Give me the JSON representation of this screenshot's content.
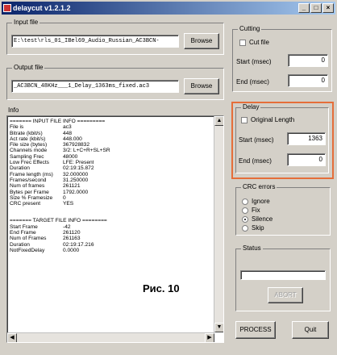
{
  "window": {
    "title": "delaycut v1.2.1.2",
    "minimize": "_",
    "maximize": "□",
    "close": "×"
  },
  "input_file": {
    "label": "Input file",
    "value": "E:\\test\\rls_01_IBel69_Audio_Russian_AC3BCN-",
    "browse": "Browse"
  },
  "output_file": {
    "label": "Output file",
    "value": "_AC3BCN_48KHz___1_Delay_1363ms_fixed.ac3",
    "browse": "Browse"
  },
  "cutting": {
    "label": "Cutting",
    "cut_file": "Cut file",
    "start_label": "Start (msec)",
    "start_value": "0",
    "end_label": "End (msec)",
    "end_value": "0"
  },
  "delay": {
    "label": "Delay",
    "original_length": "Original Length",
    "start_label": "Start (msec)",
    "start_value": "1363",
    "end_label": "End (msec)",
    "end_value": "0"
  },
  "crc": {
    "label": "CRC errors",
    "options": [
      "Ignore",
      "Fix",
      "Silence",
      "Skip"
    ],
    "selected": "Silence"
  },
  "status": {
    "label": "Status",
    "abort": "ABORT"
  },
  "buttons": {
    "process": "PROCESS",
    "quit": "Quit"
  },
  "info": {
    "label": "Info",
    "input_header": "======= INPUT FILE INFO =========",
    "input_rows": [
      {
        "k": "File is",
        "v": "ac3"
      },
      {
        "k": "Bitrate (kbit/s)",
        "v": "448"
      },
      {
        "k": "Act rate (kbit/s)",
        "v": "448.000"
      },
      {
        "k": "File size (bytes)",
        "v": "367928832"
      },
      {
        "k": "Channels mode",
        "v": "3/2: L+C+R+SL+SR"
      },
      {
        "k": "Sampling Frec",
        "v": "48000"
      },
      {
        "k": "Low Frec Effects",
        "v": "LFE: Present"
      },
      {
        "k": "Duration",
        "v": "02:19:15.872"
      },
      {
        "k": "Frame length (ms)",
        "v": "32.000000"
      },
      {
        "k": "Frames/second",
        "v": "31.250000"
      },
      {
        "k": "Num of frames",
        "v": "261121"
      },
      {
        "k": "Bytes per Frame",
        "v": "1792.0000"
      },
      {
        "k": "Size % Framesize",
        "v": "0"
      },
      {
        "k": "CRC present",
        "v": "YES"
      }
    ],
    "target_header": "======= TARGET FILE INFO ========",
    "target_rows": [
      {
        "k": "Start Frame",
        "v": "-42"
      },
      {
        "k": "End Frame",
        "v": "261120"
      },
      {
        "k": "Num of Frames",
        "v": "261163"
      },
      {
        "k": "Duration",
        "v": "02:19:17.216"
      },
      {
        "k": "NotFixedDelay",
        "v": "0.0000"
      }
    ]
  },
  "figure_caption": "Рис. 10"
}
